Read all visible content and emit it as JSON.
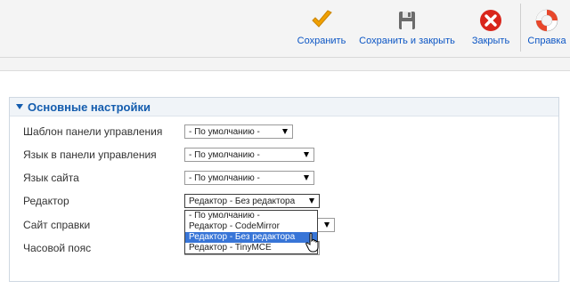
{
  "toolbar": {
    "save_label": "Сохранить",
    "save_close_label": "Сохранить и закрыть",
    "close_label": "Закрыть",
    "help_label": "Справка",
    "icons": {
      "save": "checkmark-icon",
      "save_close": "floppy-disk-icon",
      "close": "close-circle-icon",
      "help": "lifebuoy-icon"
    },
    "colors": {
      "link": "#0b55c4",
      "save_icon": "#f0a000",
      "close_icon": "#d9261c",
      "help_icon": "#e8472b"
    }
  },
  "panel": {
    "title": "Основные настройки",
    "rows": [
      {
        "label": "Шаблон панели управления",
        "value": "- По умолчанию -"
      },
      {
        "label": "Язык в панели управления",
        "value": "- По умолчанию -"
      },
      {
        "label": "Язык сайта",
        "value": "- По умолчанию -"
      },
      {
        "label": "Редактор",
        "value": "Редактор - Без редактора"
      },
      {
        "label": "Сайт справки",
        "value": ""
      },
      {
        "label": "Часовой пояс",
        "value": ""
      }
    ]
  },
  "editor_dropdown": {
    "options": [
      "- По умолчанию -",
      "Редактор - CodeMirror",
      "Редактор - Без редактора",
      "Редактор - TinyMCE"
    ],
    "selected_index": 2
  }
}
